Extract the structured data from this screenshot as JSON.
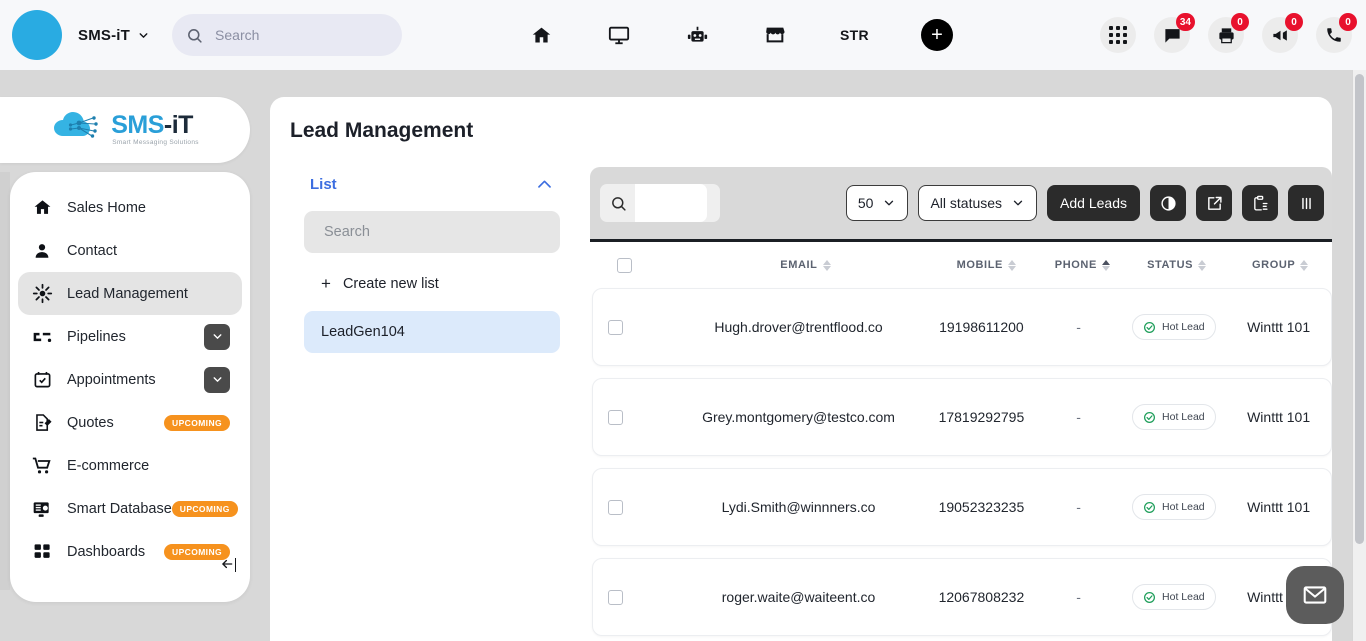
{
  "topbar": {
    "brand": "SMS-iT",
    "brand_caret_icon": "chevron-down-icon",
    "search": {
      "placeholder": "Search",
      "value": "",
      "icon": "search-icon"
    },
    "nav": [
      {
        "name": "home",
        "icon": "home-icon",
        "label": ""
      },
      {
        "name": "display",
        "icon": "monitor-icon",
        "label": ""
      },
      {
        "name": "bot",
        "icon": "robot-icon",
        "label": ""
      },
      {
        "name": "store",
        "icon": "storefront-icon",
        "label": ""
      },
      {
        "name": "str",
        "icon": "text",
        "label": "STR"
      }
    ],
    "add_button": {
      "icon": "plus-icon",
      "label": "+"
    },
    "right_icons": [
      {
        "name": "apps-grid",
        "icon": "grid-dots-icon",
        "badge": null
      },
      {
        "name": "messages",
        "icon": "chat-bubble-icon",
        "badge": "34"
      },
      {
        "name": "print",
        "icon": "printer-icon",
        "badge": "0"
      },
      {
        "name": "announcements",
        "icon": "megaphone-icon",
        "badge": "0"
      },
      {
        "name": "calls",
        "icon": "phone-icon",
        "badge": "0"
      }
    ]
  },
  "logo": {
    "main_blue": "SMS",
    "main_dark": "-iT",
    "tagline": "Smart Messaging Solutions"
  },
  "sidebar": {
    "items": [
      {
        "label": "Sales Home",
        "icon": "home-icon",
        "active": false,
        "chevron": false,
        "badge": ""
      },
      {
        "label": "Contact",
        "icon": "person-icon",
        "active": false,
        "chevron": false,
        "badge": ""
      },
      {
        "label": "Lead Management",
        "icon": "lead-target-icon",
        "active": true,
        "chevron": false,
        "badge": ""
      },
      {
        "label": "Pipelines",
        "icon": "pipeline-icon",
        "active": false,
        "chevron": true,
        "badge": ""
      },
      {
        "label": "Appointments",
        "icon": "calendar-check-icon",
        "active": false,
        "chevron": true,
        "badge": ""
      },
      {
        "label": "Quotes",
        "icon": "document-edit-icon",
        "active": false,
        "chevron": false,
        "badge": "UPCOMING"
      },
      {
        "label": "E-commerce",
        "icon": "shopping-cart-icon",
        "active": false,
        "chevron": false,
        "badge": ""
      },
      {
        "label": "Smart Database",
        "icon": "database-monitor-icon",
        "active": false,
        "chevron": false,
        "badge": "UPCOMING"
      },
      {
        "label": "Dashboards",
        "icon": "dashboard-grid-icon",
        "active": false,
        "chevron": false,
        "badge": "UPCOMING"
      }
    ],
    "collapse_icon": "arrow-left-icon"
  },
  "main": {
    "page_title": "Lead Management",
    "list_panel": {
      "title": "List",
      "collapse_icon": "chevron-up-icon",
      "search_placeholder": "Search",
      "search_value": "",
      "create_label": "Create new list",
      "create_icon": "plus-icon",
      "lists": [
        {
          "label": "LeadGen104",
          "selected": true
        }
      ]
    },
    "toolbar": {
      "search_icon": "search-icon",
      "search_value": "",
      "page_size": "50",
      "page_size_caret": "chevron-down-icon",
      "status_filter": "All statuses",
      "status_caret": "chevron-down-icon",
      "add_leads_label": "Add Leads",
      "icon_buttons": [
        {
          "name": "contrast-toggle",
          "icon": "half-circle-icon"
        },
        {
          "name": "compose",
          "icon": "pencil-square-icon"
        },
        {
          "name": "clipboard-list",
          "icon": "clipboard-list-icon"
        },
        {
          "name": "columns",
          "icon": "columns-icon"
        }
      ]
    },
    "table": {
      "select_all": false,
      "columns": [
        {
          "key": "email",
          "label": "EMAIL",
          "sort": "none"
        },
        {
          "key": "mobile",
          "label": "MOBILE",
          "sort": "none"
        },
        {
          "key": "phone",
          "label": "PHONE",
          "sort": "asc"
        },
        {
          "key": "status",
          "label": "STATUS",
          "sort": "none"
        },
        {
          "key": "group",
          "label": "GROUP",
          "sort": "none"
        }
      ],
      "rows": [
        {
          "checked": false,
          "email": "Hugh.drover@trentflood.co",
          "mobile": "19198611200",
          "phone": "-",
          "status": "Hot Lead",
          "status_icon": "check-circle-icon",
          "group": "Winttt 101"
        },
        {
          "checked": false,
          "email": "Grey.montgomery@testco.com",
          "mobile": "17819292795",
          "phone": "-",
          "status": "Hot Lead",
          "status_icon": "check-circle-icon",
          "group": "Winttt 101"
        },
        {
          "checked": false,
          "email": "Lydi.Smith@winnners.co",
          "mobile": "19052323235",
          "phone": "-",
          "status": "Hot Lead",
          "status_icon": "check-circle-icon",
          "group": "Winttt 101"
        },
        {
          "checked": false,
          "email": "roger.waite@waiteent.co",
          "mobile": "12067808232",
          "phone": "-",
          "status": "Hot Lead",
          "status_icon": "check-circle-icon",
          "group": "Winttt 101"
        }
      ]
    },
    "fab": {
      "name": "mail-fab",
      "icon": "envelope-icon"
    }
  },
  "colors": {
    "accent_blue": "#29abe2",
    "link_blue": "#3d6ee0",
    "badge_red": "#e8112d",
    "upcoming_orange": "#f6921e",
    "status_green": "#1e9e5a",
    "dark_button": "#2b2b2b"
  }
}
